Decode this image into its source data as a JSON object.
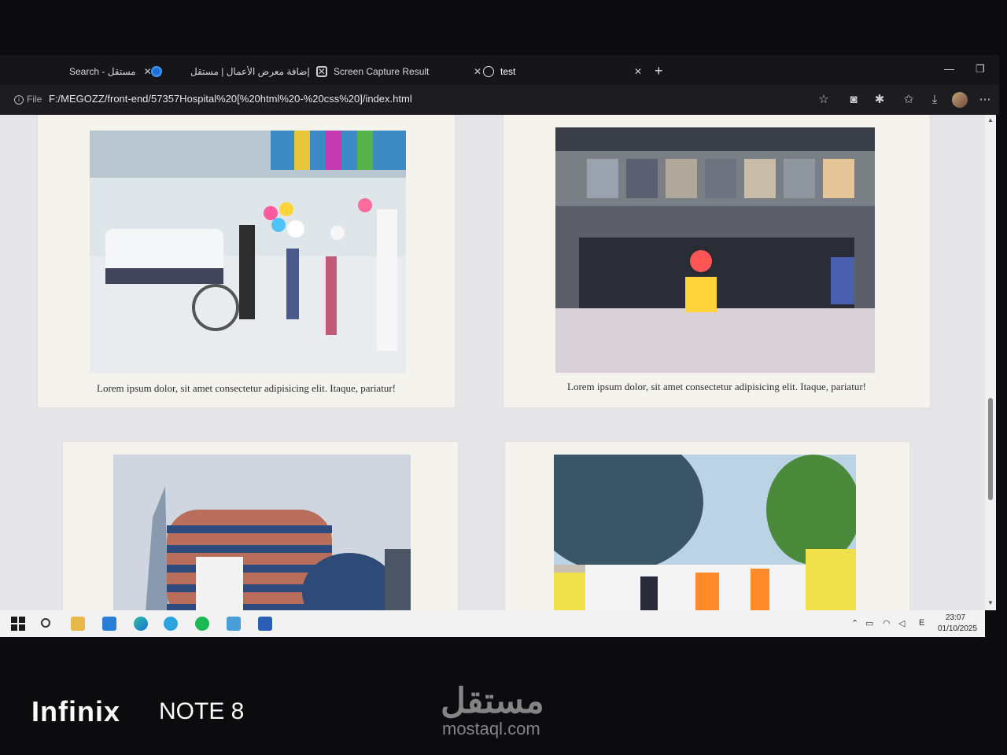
{
  "browser": {
    "tabs": [
      {
        "title": "Search - مستقل",
        "active": false
      },
      {
        "title": "إضافة معرض الأعمال | مستقل",
        "active": false
      },
      {
        "title": "Screen Capture Result",
        "active": false
      },
      {
        "title": "test",
        "active": true
      }
    ],
    "address": {
      "scheme_label": "File",
      "url": "F:/MEGOZZ/front-end/57357Hospital%20[%20html%20-%20css%20]/index.html"
    }
  },
  "page": {
    "cards": [
      {
        "caption": "Lorem ipsum dolor, sit amet consectetur adipisicing elit. Itaque, pariatur!"
      },
      {
        "caption": "Lorem ipsum dolor, sit amet consectetur adipisicing elit. Itaque, pariatur!"
      },
      {
        "caption": ""
      },
      {
        "caption": ""
      }
    ]
  },
  "taskbar": {
    "clock_time": "23:07",
    "clock_date": "01/10/2025",
    "lang": "E"
  },
  "watermark": {
    "phone_brand": "Infinix",
    "phone_model": "NOTE 8",
    "site_arabic": "مستقل",
    "site_latin": "mostaql.com"
  }
}
